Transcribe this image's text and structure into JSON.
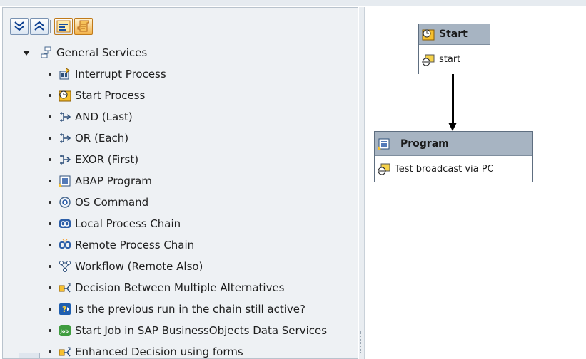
{
  "toolbar": {
    "buttons": [
      {
        "name": "expand-all-button",
        "icon": "double-chevron-down-icon"
      },
      {
        "name": "collapse-all-button",
        "icon": "double-chevron-up-icon"
      },
      {
        "name": "find-button",
        "icon": "find-icon"
      },
      {
        "name": "scroll-button",
        "icon": "scroll-icon"
      }
    ]
  },
  "tree": {
    "root_label": "General Services",
    "items": [
      {
        "label": "Interrupt Process",
        "icon": "interrupt-icon"
      },
      {
        "label": "Start Process",
        "icon": "clock-icon"
      },
      {
        "label": "AND (Last)",
        "icon": "branch-icon"
      },
      {
        "label": "OR (Each)",
        "icon": "branch-icon"
      },
      {
        "label": "EXOR (First)",
        "icon": "branch-icon"
      },
      {
        "label": "ABAP Program",
        "icon": "program-icon"
      },
      {
        "label": "OS Command",
        "icon": "os-command-icon"
      },
      {
        "label": "Local Process Chain",
        "icon": "local-chain-icon"
      },
      {
        "label": "Remote Process Chain",
        "icon": "remote-chain-icon"
      },
      {
        "label": "Workflow (Remote Also)",
        "icon": "workflow-icon"
      },
      {
        "label": "Decision Between Multiple Alternatives",
        "icon": "decision-icon"
      },
      {
        "label": "Is the previous run in the chain still active?",
        "icon": "question-icon"
      },
      {
        "label": "Start Job in SAP BusinessObjects Data Services",
        "icon": "job-icon"
      },
      {
        "label": "Enhanced Decision using forms",
        "icon": "decision-icon"
      }
    ]
  },
  "diagram": {
    "start_node": {
      "title": "Start",
      "variant": "start"
    },
    "program_node": {
      "title": "Program",
      "variant": "Test broadcast via PC"
    }
  },
  "colors": {
    "node_header": "#a7b4c2",
    "toolbar_orange": "#f3b34a",
    "pane_background": "#eef1f4"
  }
}
